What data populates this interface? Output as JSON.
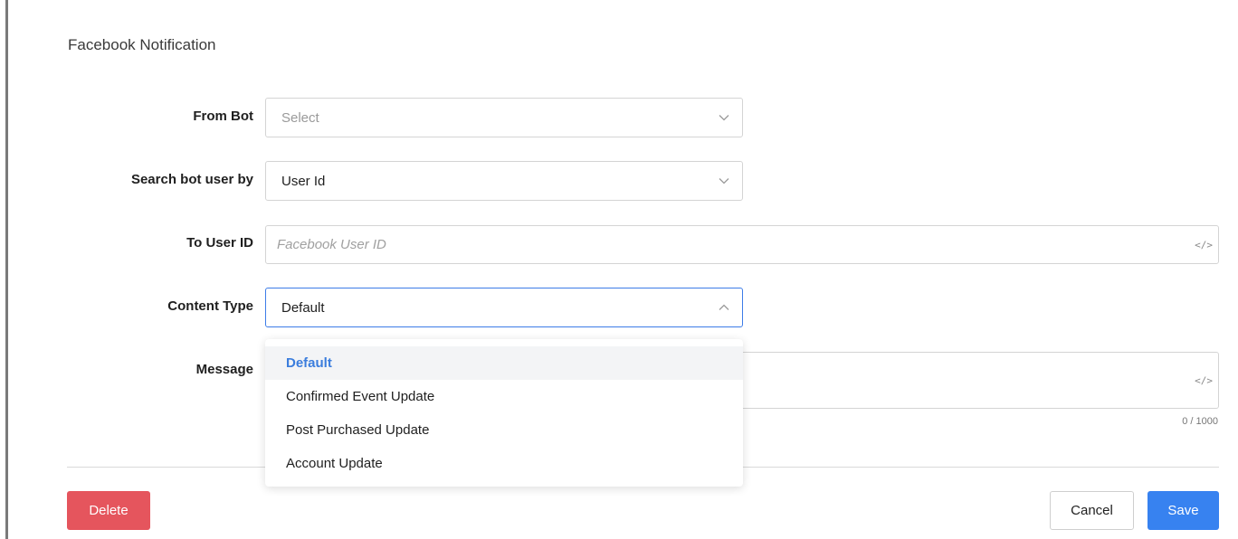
{
  "title": "Facebook Notification",
  "form": {
    "from_bot": {
      "label": "From Bot",
      "placeholder": "Select"
    },
    "search_by": {
      "label": "Search bot user by",
      "value": "User Id"
    },
    "to_user": {
      "label": "To User ID",
      "placeholder": "Facebook User ID",
      "code_icon": "</>"
    },
    "content_type": {
      "label": "Content Type",
      "value": "Default"
    },
    "message": {
      "label": "Message",
      "code_icon": "</>",
      "counter": "0 / 1000"
    }
  },
  "dropdown": {
    "options": [
      {
        "label": "Default",
        "selected": true
      },
      {
        "label": "Confirmed Event Update",
        "selected": false
      },
      {
        "label": "Post Purchased Update",
        "selected": false
      },
      {
        "label": "Account Update",
        "selected": false
      }
    ]
  },
  "buttons": {
    "delete": "Delete",
    "cancel": "Cancel",
    "save": "Save"
  },
  "colors": {
    "accent": "#3782f0",
    "danger": "#e5555d",
    "selected_text": "#3b7ddd"
  },
  "icons": {
    "chevron_down": "chevron-down-icon",
    "chevron_up": "chevron-up-icon",
    "code": "code-icon"
  }
}
